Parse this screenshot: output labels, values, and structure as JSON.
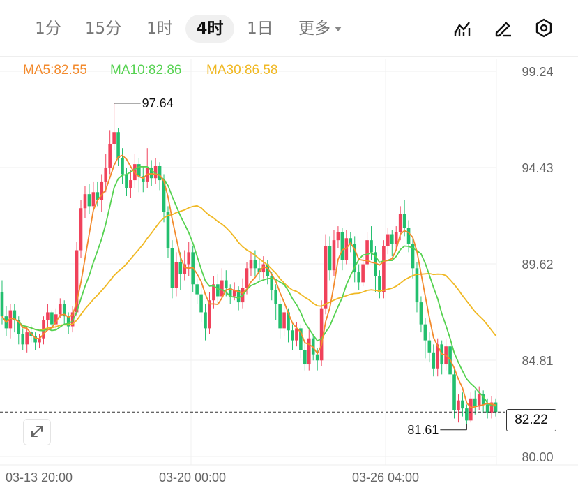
{
  "tabs": [
    {
      "label": "1分"
    },
    {
      "label": "15分"
    },
    {
      "label": "1时"
    },
    {
      "label": "4时",
      "active": true
    },
    {
      "label": "1日"
    },
    {
      "label": "更多"
    }
  ],
  "toolbar": {
    "icons": [
      "chart-indicator-icon",
      "draw-pen-icon",
      "settings-hexagon-icon"
    ]
  },
  "ma": {
    "ma5": "MA5:82.55",
    "ma10": "MA10:82.86",
    "ma30": "MA30:86.58"
  },
  "colors": {
    "up": "#f0425b",
    "down": "#22bf6e",
    "ma5": "#f38a2c",
    "ma10": "#55d250",
    "ma30": "#f0b823"
  },
  "chart_data": {
    "type": "candlestick",
    "y_ticks": [
      "99.24",
      "94.43",
      "89.62",
      "84.81",
      "80.00"
    ],
    "y_tick_values": [
      99.24,
      94.43,
      89.62,
      84.81,
      80.0
    ],
    "x_ticks": [
      "03-13 20:00",
      "03-20 00:00",
      "03-26 04:00"
    ],
    "high_label": "97.64",
    "low_label": "81.61",
    "current_price": "82.22",
    "ylim": [
      80.0,
      99.24
    ],
    "candles": [
      [
        88.2,
        87.0,
        88.8,
        86.6
      ],
      [
        87.0,
        86.4,
        87.5,
        86.0
      ],
      [
        86.4,
        87.3,
        87.6,
        85.9
      ],
      [
        87.3,
        86.8,
        87.6,
        86.2
      ],
      [
        86.8,
        86.1,
        87.0,
        85.6
      ],
      [
        86.1,
        85.6,
        86.4,
        85.3
      ],
      [
        85.6,
        86.2,
        86.5,
        85.2
      ],
      [
        86.2,
        86.0,
        86.6,
        85.7
      ],
      [
        86.0,
        85.7,
        86.2,
        85.3
      ],
      [
        85.7,
        85.9,
        86.1,
        85.4
      ],
      [
        85.9,
        86.8,
        87.0,
        85.6
      ],
      [
        86.8,
        87.2,
        87.6,
        86.4
      ],
      [
        87.2,
        86.6,
        87.3,
        86.2
      ],
      [
        86.6,
        87.1,
        87.4,
        86.3
      ],
      [
        87.1,
        87.6,
        87.9,
        86.9
      ],
      [
        87.6,
        87.0,
        87.8,
        86.6
      ],
      [
        87.0,
        86.5,
        87.2,
        86.1
      ],
      [
        86.5,
        87.2,
        87.5,
        86.2
      ],
      [
        87.2,
        90.3,
        90.7,
        87.0
      ],
      [
        90.3,
        92.4,
        92.8,
        89.9
      ],
      [
        92.4,
        93.1,
        93.5,
        91.9
      ],
      [
        93.1,
        92.5,
        93.6,
        92.1
      ],
      [
        92.5,
        93.2,
        93.7,
        92.2
      ],
      [
        93.2,
        92.8,
        93.7,
        92.5
      ],
      [
        92.8,
        93.7,
        94.1,
        92.2
      ],
      [
        93.7,
        94.4,
        95.1,
        93.2
      ],
      [
        94.4,
        95.6,
        96.3,
        94.1
      ],
      [
        95.6,
        96.2,
        97.64,
        95.3
      ],
      [
        96.2,
        94.9,
        96.4,
        94.5
      ],
      [
        94.9,
        94.1,
        95.4,
        93.6
      ],
      [
        94.1,
        93.4,
        94.4,
        93.0
      ],
      [
        93.4,
        93.8,
        94.3,
        92.9
      ],
      [
        93.8,
        94.6,
        95.1,
        93.4
      ],
      [
        94.6,
        94.0,
        94.9,
        93.2
      ],
      [
        94.0,
        93.7,
        94.5,
        93.2
      ],
      [
        93.7,
        94.4,
        95.4,
        93.4
      ],
      [
        94.4,
        93.9,
        94.8,
        93.5
      ],
      [
        93.9,
        94.5,
        94.9,
        93.6
      ],
      [
        94.5,
        93.8,
        94.7,
        93.3
      ],
      [
        93.8,
        92.2,
        94.1,
        91.7
      ],
      [
        92.2,
        90.4,
        92.5,
        89.9
      ],
      [
        90.4,
        88.4,
        90.8,
        87.9
      ],
      [
        88.4,
        89.7,
        90.2,
        88.0
      ],
      [
        89.7,
        89.1,
        90.2,
        88.3
      ],
      [
        89.1,
        89.6,
        90.3,
        88.8
      ],
      [
        89.6,
        90.2,
        90.7,
        89.0
      ],
      [
        90.2,
        88.6,
        90.5,
        88.2
      ],
      [
        88.6,
        88.1,
        88.9,
        87.6
      ],
      [
        88.1,
        87.2,
        88.5,
        86.7
      ],
      [
        87.2,
        86.4,
        87.6,
        85.8
      ],
      [
        86.4,
        87.8,
        88.2,
        86.1
      ],
      [
        87.8,
        88.6,
        89.0,
        87.4
      ],
      [
        88.6,
        88.0,
        89.1,
        87.6
      ],
      [
        88.0,
        88.8,
        89.4,
        87.8
      ],
      [
        88.8,
        88.4,
        89.3,
        88.0
      ],
      [
        88.4,
        88.0,
        88.6,
        87.6
      ],
      [
        88.0,
        88.3,
        88.7,
        87.8
      ],
      [
        88.3,
        87.7,
        88.5,
        87.3
      ],
      [
        87.7,
        88.4,
        88.9,
        87.4
      ],
      [
        88.4,
        89.4,
        89.7,
        88.1
      ],
      [
        89.4,
        89.8,
        90.2,
        89.0
      ],
      [
        89.8,
        89.4,
        90.3,
        89.0
      ],
      [
        89.4,
        89.2,
        89.8,
        88.8
      ],
      [
        89.2,
        89.6,
        90.0,
        88.9
      ],
      [
        89.6,
        89.0,
        89.8,
        88.6
      ],
      [
        89.0,
        88.3,
        89.2,
        87.8
      ],
      [
        88.3,
        87.6,
        88.6,
        86.8
      ],
      [
        87.6,
        86.4,
        87.9,
        85.9
      ],
      [
        86.4,
        87.2,
        87.6,
        86.0
      ],
      [
        87.2,
        86.3,
        87.4,
        85.7
      ],
      [
        86.3,
        85.8,
        86.6,
        85.3
      ],
      [
        85.8,
        86.4,
        86.7,
        85.5
      ],
      [
        86.4,
        85.3,
        86.6,
        84.9
      ],
      [
        85.3,
        84.6,
        85.7,
        84.3
      ],
      [
        84.6,
        85.9,
        86.4,
        84.3
      ],
      [
        85.9,
        85.1,
        86.1,
        84.8
      ],
      [
        85.1,
        84.8,
        85.4,
        84.3
      ],
      [
        84.8,
        87.4,
        87.8,
        84.5
      ],
      [
        87.4,
        90.5,
        91.1,
        87.1
      ],
      [
        90.5,
        89.3,
        91.0,
        88.8
      ],
      [
        89.3,
        90.8,
        91.3,
        89.0
      ],
      [
        90.8,
        91.2,
        91.5,
        90.4
      ],
      [
        91.2,
        89.8,
        91.4,
        89.3
      ],
      [
        89.8,
        90.9,
        91.3,
        89.6
      ],
      [
        90.9,
        90.6,
        91.2,
        90.2
      ],
      [
        90.6,
        89.2,
        91.0,
        88.7
      ],
      [
        89.2,
        88.7,
        89.6,
        88.3
      ],
      [
        88.7,
        89.6,
        90.0,
        88.5
      ],
      [
        89.6,
        90.8,
        91.2,
        89.4
      ],
      [
        90.8,
        90.2,
        91.5,
        89.8
      ],
      [
        90.2,
        89.0,
        90.5,
        88.2
      ],
      [
        89.0,
        88.2,
        89.3,
        87.9
      ],
      [
        88.2,
        90.5,
        90.8,
        87.9
      ],
      [
        90.5,
        91.1,
        91.4,
        90.1
      ],
      [
        91.1,
        90.6,
        91.3,
        90.0
      ],
      [
        90.6,
        91.2,
        91.5,
        90.3
      ],
      [
        91.2,
        92.1,
        92.5,
        90.8
      ],
      [
        92.1,
        91.4,
        92.8,
        91.0
      ],
      [
        91.4,
        90.6,
        91.8,
        90.2
      ],
      [
        90.6,
        89.4,
        90.9,
        88.9
      ],
      [
        89.4,
        87.7,
        89.7,
        87.2
      ],
      [
        87.7,
        86.6,
        88.0,
        86.2
      ],
      [
        86.6,
        85.8,
        86.9,
        84.9
      ],
      [
        85.8,
        85.2,
        86.2,
        84.7
      ],
      [
        85.2,
        84.4,
        85.6,
        84.0
      ],
      [
        84.4,
        85.6,
        85.9,
        84.0
      ],
      [
        85.6,
        84.6,
        85.8,
        84.1
      ],
      [
        84.6,
        85.5,
        85.9,
        84.3
      ],
      [
        85.5,
        84.1,
        85.7,
        83.7
      ],
      [
        84.1,
        82.3,
        84.4,
        81.9
      ],
      [
        82.3,
        82.8,
        83.1,
        81.7
      ],
      [
        82.8,
        82.4,
        83.2,
        82.0
      ],
      [
        82.4,
        81.8,
        82.6,
        81.61
      ],
      [
        81.8,
        82.9,
        83.2,
        81.7
      ],
      [
        82.9,
        82.5,
        83.3,
        82.1
      ],
      [
        82.5,
        83.1,
        83.5,
        82.3
      ],
      [
        83.1,
        82.6,
        83.3,
        82.2
      ],
      [
        82.6,
        82.2,
        82.9,
        81.9
      ],
      [
        82.2,
        82.7,
        83.0,
        81.9
      ],
      [
        82.7,
        82.22,
        82.9,
        82.0
      ]
    ]
  }
}
